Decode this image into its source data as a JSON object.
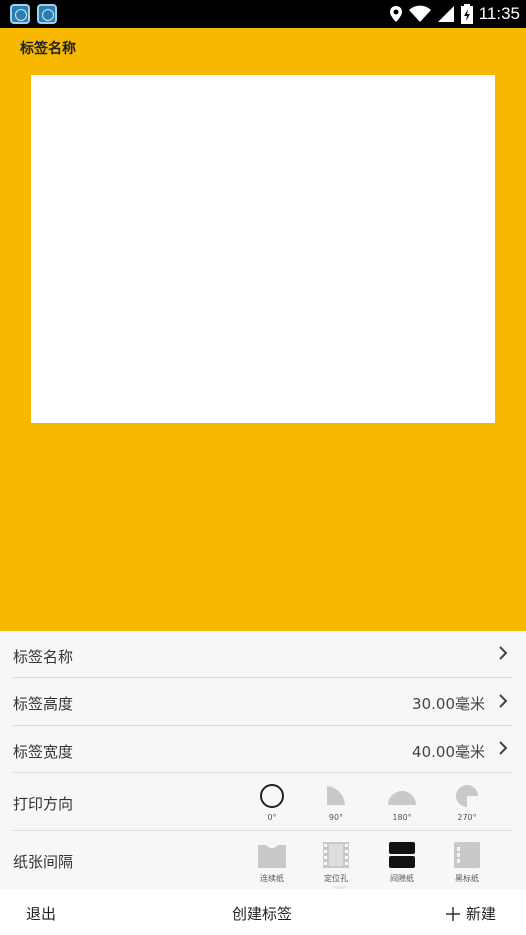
{
  "label": {
    "title": "标签名称"
  },
  "settings": {
    "name": {
      "label": "标签名称"
    },
    "height": {
      "label": "标签高度",
      "value": "30.00毫米"
    },
    "width": {
      "label": "标签宽度",
      "value": "40.00毫米"
    },
    "direction": {
      "label": "打印方向",
      "options": [
        {
          "caption": "0°",
          "icon": "circle-full-icon",
          "selected": true
        },
        {
          "caption": "90°",
          "icon": "quarter-circle-icon"
        },
        {
          "caption": "180°",
          "icon": "half-circle-icon"
        },
        {
          "caption": "270°",
          "icon": "three-quarter-circle-icon"
        }
      ]
    },
    "paper_gap": {
      "label": "纸张间隔",
      "options": [
        {
          "caption": "连续纸",
          "icon": "continuous-paper-icon"
        },
        {
          "caption": "定位孔",
          "icon": "locating-hole-icon"
        },
        {
          "caption": "间隙纸",
          "icon": "gap-paper-icon",
          "selected": true
        },
        {
          "caption": "黑标纸",
          "icon": "black-mark-paper-icon"
        }
      ]
    }
  },
  "bottom_bar": {
    "exit": "退出",
    "create": "创建标签",
    "new": "新建"
  },
  "status_bar": {
    "time": "11:35"
  },
  "colors": {
    "accent": "#f9b800",
    "panel": "#f7f7f7"
  }
}
